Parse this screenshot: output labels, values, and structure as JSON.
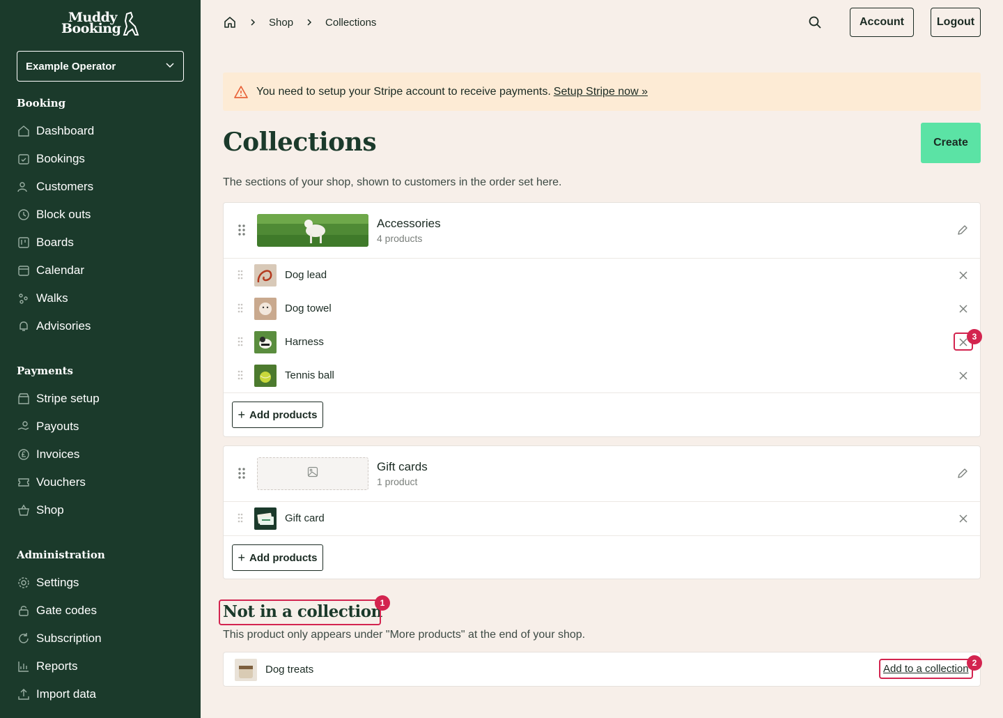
{
  "brand": {
    "line1": "Muddy",
    "line2": "Booking"
  },
  "operator": {
    "name": "Example Operator"
  },
  "sidebar": {
    "sections": [
      {
        "heading": "Booking",
        "items": [
          {
            "label": "Dashboard",
            "icon": "home-icon"
          },
          {
            "label": "Bookings",
            "icon": "calendar-check-icon"
          },
          {
            "label": "Customers",
            "icon": "users-icon"
          },
          {
            "label": "Block outs",
            "icon": "clock-icon"
          },
          {
            "label": "Boards",
            "icon": "board-icon"
          },
          {
            "label": "Calendar",
            "icon": "calendar-icon"
          },
          {
            "label": "Walks",
            "icon": "paw-icon"
          },
          {
            "label": "Advisories",
            "icon": "bell-icon"
          }
        ]
      },
      {
        "heading": "Payments",
        "items": [
          {
            "label": "Stripe setup",
            "icon": "store-icon"
          },
          {
            "label": "Payouts",
            "icon": "hand-coins-icon"
          },
          {
            "label": "Invoices",
            "icon": "pound-circle-icon"
          },
          {
            "label": "Vouchers",
            "icon": "ticket-icon"
          },
          {
            "label": "Shop",
            "icon": "basket-icon"
          }
        ]
      },
      {
        "heading": "Administration",
        "items": [
          {
            "label": "Settings",
            "icon": "gear-icon"
          },
          {
            "label": "Gate codes",
            "icon": "lock-icon"
          },
          {
            "label": "Subscription",
            "icon": "refresh-icon"
          },
          {
            "label": "Reports",
            "icon": "chart-icon"
          },
          {
            "label": "Import data",
            "icon": "upload-icon"
          }
        ]
      }
    ]
  },
  "breadcrumb": {
    "items": [
      "Shop",
      "Collections"
    ]
  },
  "header": {
    "account_label": "Account",
    "logout_label": "Logout"
  },
  "alert": {
    "text": "You need to setup your Stripe account to receive payments.",
    "link": "Setup Stripe now »"
  },
  "page": {
    "title": "Collections",
    "create_label": "Create",
    "subtitle": "The sections of your shop, shown to customers in the order set here."
  },
  "collections": [
    {
      "name": "Accessories",
      "count": "4 products",
      "products": [
        "Dog lead",
        "Dog towel",
        "Harness",
        "Tennis ball"
      ],
      "add_label": "Add products"
    },
    {
      "name": "Gift cards",
      "count": "1 product",
      "products": [
        "Gift card"
      ],
      "add_label": "Add products"
    }
  ],
  "not_in_collection": {
    "title": "Not in a collection",
    "subtitle": "This product only appears under \"More products\" at the end of your shop.",
    "products": [
      {
        "name": "Dog treats",
        "action": "Add to a collection"
      }
    ]
  },
  "annotations": [
    "1",
    "2",
    "3"
  ],
  "colors": {
    "sidebar": "#1b3a2b",
    "background": "#f7efe9",
    "accent": "#5be3a5",
    "alert": "#fdebd5",
    "highlight": "#d3244f"
  }
}
